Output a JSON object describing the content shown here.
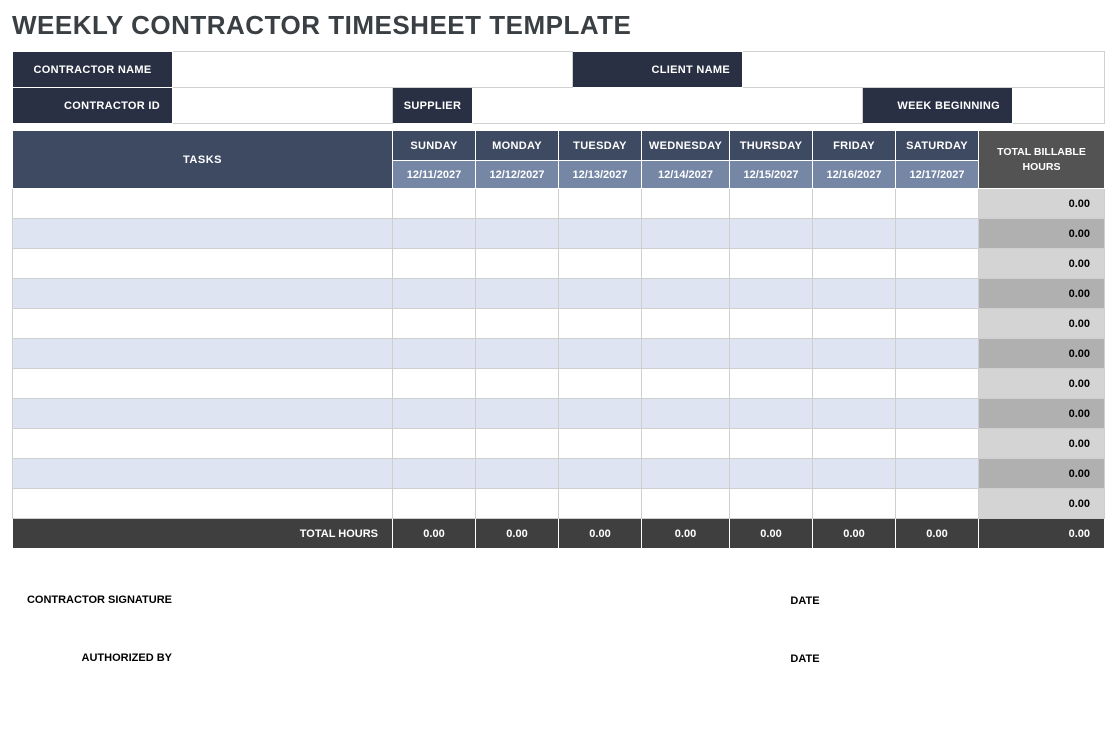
{
  "title": "WEEKLY CONTRACTOR TIMESHEET TEMPLATE",
  "info": {
    "contractor_name_label": "CONTRACTOR NAME",
    "client_name_label": "CLIENT NAME",
    "contractor_id_label": "CONTRACTOR ID",
    "supplier_label": "SUPPLIER",
    "week_beginning_label": "WEEK BEGINNING",
    "contractor_name": "",
    "client_name": "",
    "contractor_id": "",
    "supplier": "",
    "week_beginning": ""
  },
  "headers": {
    "tasks": "TASKS",
    "total_billable": "TOTAL BILLABLE HOURS",
    "days": [
      "SUNDAY",
      "MONDAY",
      "TUESDAY",
      "WEDNESDAY",
      "THURSDAY",
      "FRIDAY",
      "SATURDAY"
    ],
    "dates": [
      "12/11/2027",
      "12/12/2027",
      "12/13/2027",
      "12/14/2027",
      "12/15/2027",
      "12/16/2027",
      "12/17/2027"
    ]
  },
  "rows": [
    {
      "task": "",
      "total": "0.00"
    },
    {
      "task": "",
      "total": "0.00"
    },
    {
      "task": "",
      "total": "0.00"
    },
    {
      "task": "",
      "total": "0.00"
    },
    {
      "task": "",
      "total": "0.00"
    },
    {
      "task": "",
      "total": "0.00"
    },
    {
      "task": "",
      "total": "0.00"
    },
    {
      "task": "",
      "total": "0.00"
    },
    {
      "task": "",
      "total": "0.00"
    },
    {
      "task": "",
      "total": "0.00"
    },
    {
      "task": "",
      "total": "0.00"
    }
  ],
  "totals": {
    "label": "TOTAL HOURS",
    "values": [
      "0.00",
      "0.00",
      "0.00",
      "0.00",
      "0.00",
      "0.00",
      "0.00"
    ],
    "grand": "0.00"
  },
  "sig": {
    "contractor_signature_label": "CONTRACTOR SIGNATURE",
    "authorized_by_label": "AUTHORIZED BY",
    "date_label": "DATE"
  }
}
